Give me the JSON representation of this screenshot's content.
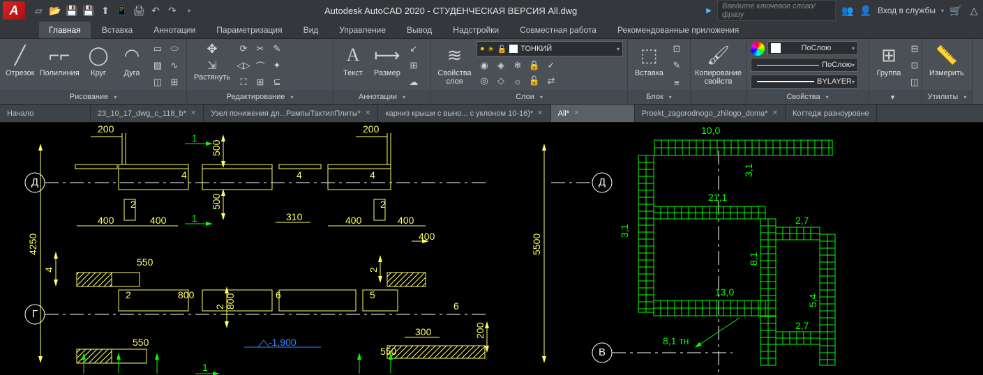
{
  "title": "Autodesk AutoCAD 2020 - СТУДЕНЧЕСКАЯ ВЕРСИЯ    All.dwg",
  "search_placeholder": "Введите ключевое слово/фразу",
  "signin": "Вход в службы",
  "ribbon_tabs": [
    "Главная",
    "Вставка",
    "Аннотации",
    "Параметризация",
    "Вид",
    "Управление",
    "Вывод",
    "Надстройки",
    "Совместная работа",
    "Рекомендованные приложения"
  ],
  "active_ribbon_tab": 0,
  "panels": {
    "draw": {
      "label": "Рисование",
      "line": "Отрезок",
      "polyline": "Полилиния",
      "circle": "Круг",
      "arc": "Дуга"
    },
    "modify": {
      "label": "Редактирование",
      "stretch": "Растянуть"
    },
    "annotation": {
      "label": "Аннотации",
      "text": "Текст",
      "dimension": "Размер"
    },
    "layers": {
      "label": "Слои",
      "props": "Свойства\nслоя",
      "current": "ТОНКИЙ"
    },
    "block": {
      "label": "Блок",
      "insert": "Вставка"
    },
    "clipboard": {
      "label": "",
      "copy": "Копирование\nсвойств"
    },
    "properties": {
      "label": "Свойства",
      "color": "ПоСлою",
      "ltype": "ПоСлою",
      "lweight": "BYLAYER"
    },
    "group": {
      "label": "",
      "group": "Группа"
    },
    "utilities": {
      "label": "Утилиты",
      "measure": "Измерить"
    }
  },
  "file_tabs": [
    {
      "label": "Начало",
      "closable": false
    },
    {
      "label": "23_10_17_dwg_c_118_b*",
      "closable": true
    },
    {
      "label": "Узел понижения дл...РампыТактилПлиты*",
      "closable": true
    },
    {
      "label": "карниз крыши с выно... с уклоном 10-16)*",
      "closable": true
    },
    {
      "label": "All*",
      "closable": true,
      "active": true
    },
    {
      "label": "Proekt_zagorodnogo_zhilogo_doma*",
      "closable": true
    },
    {
      "label": "Коттедж разноуровне",
      "closable": false
    }
  ],
  "drawing": {
    "axes_left": [
      "Д",
      "Г"
    ],
    "axes_right": [
      "Д",
      "В"
    ],
    "left_dims": [
      "200",
      "200",
      "4",
      "1",
      "4",
      "1",
      "500",
      "500",
      "2",
      "2",
      "400",
      "400",
      "310",
      "400",
      "400",
      "4",
      "2",
      "550",
      "550",
      "2",
      "2",
      "2",
      "800",
      "800",
      "6",
      "6",
      "5",
      "5",
      "6",
      "6",
      "4250",
      "5500",
      "300",
      "200",
      "-1,900",
      "1"
    ],
    "right_dims": [
      "10,0",
      "3,1",
      "3,1",
      "21,1",
      "2,7",
      "8,1",
      "13,0",
      "5,4",
      "2,7",
      "8,1 тн"
    ]
  }
}
